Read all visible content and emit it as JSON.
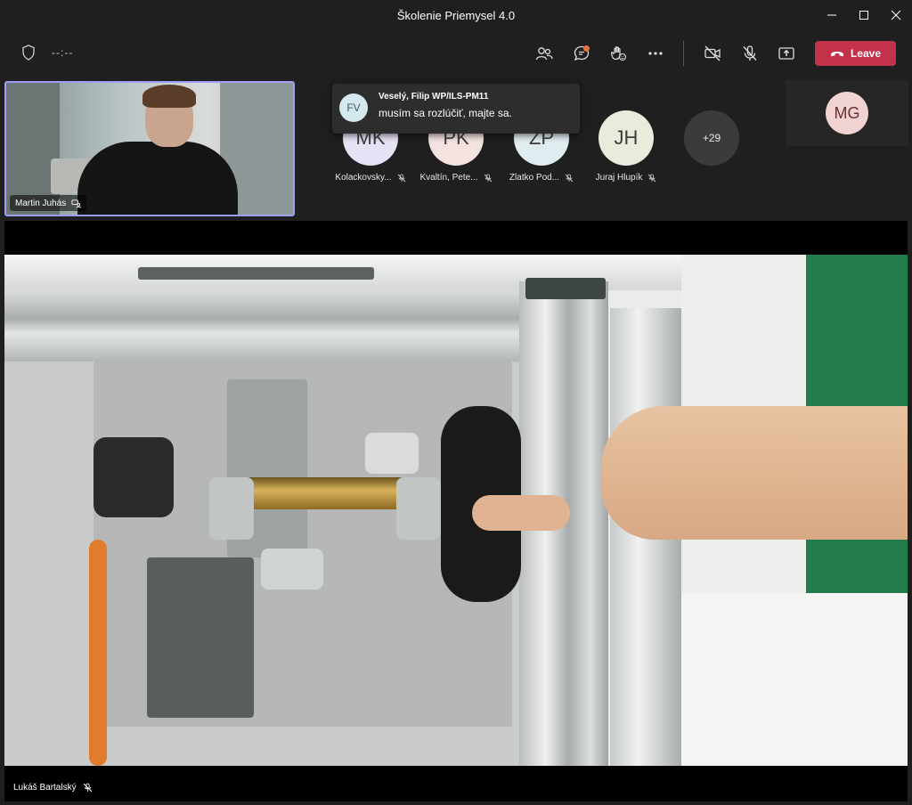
{
  "window": {
    "title": "Školenie Priemysel 4.0"
  },
  "toolbar": {
    "timer": "--:--",
    "leave_label": "Leave",
    "leave_color": "#c4314b",
    "icons": [
      "shield-icon",
      "people-icon",
      "chat-icon",
      "react-icon",
      "more-icon",
      "camera-off-icon",
      "mic-off-icon",
      "share-icon"
    ]
  },
  "self_view": {
    "name": "Martin Juhás"
  },
  "participants": [
    {
      "initials": "MK",
      "name": "Kolackovsky...",
      "color": "#e7e1f5"
    },
    {
      "initials": "PK",
      "name": "Kvaltín, Pete...",
      "color": "#f3e2df"
    },
    {
      "initials": "ZP",
      "name": "Zlatko Pod...",
      "color": "#dfecf0"
    },
    {
      "initials": "JH",
      "name": "Juraj Hlupík",
      "color": "#e7ecdb"
    }
  ],
  "more_participants": "+29",
  "spotlight_tile": {
    "initials": "MG"
  },
  "toast": {
    "initials": "FV",
    "sender": "Veselý, Filip WP/ILS-PM11",
    "message": "musím sa rozlúčiť, majte sa."
  },
  "main_video": {
    "speaker_name": "Lukáš Bartalský"
  }
}
